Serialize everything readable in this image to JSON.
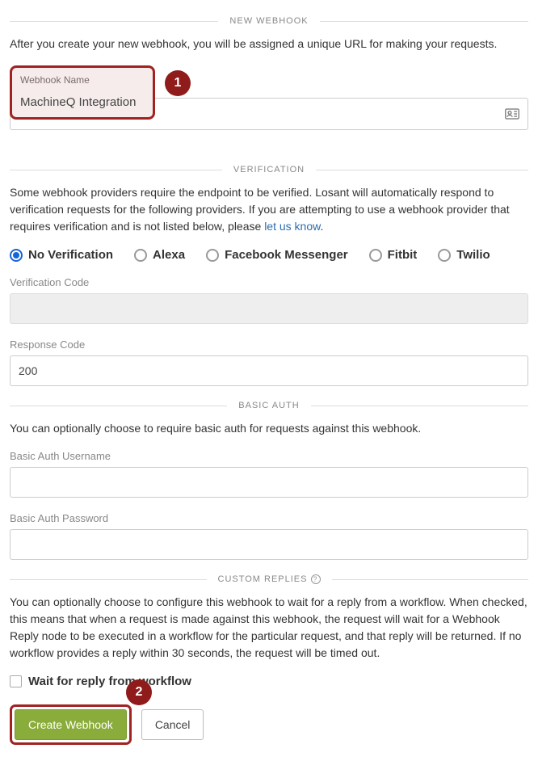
{
  "sections": {
    "new_webhook": {
      "title": "NEW WEBHOOK",
      "desc": "After you create your new webhook, you will be assigned a unique URL for making your requests.",
      "name_label": "Webhook Name",
      "name_value": "MachineQ Integration"
    },
    "verification": {
      "title": "VERIFICATION",
      "desc_prefix": "Some webhook providers require the endpoint to be verified. Losant will automatically respond to verification requests for the following providers. If you are attempting to use a webhook provider that requires verification and is not listed below, please ",
      "desc_link": "let us know",
      "desc_suffix": ".",
      "options": [
        "No Verification",
        "Alexa",
        "Facebook Messenger",
        "Fitbit",
        "Twilio"
      ],
      "selected": "No Verification",
      "verification_code_label": "Verification Code",
      "verification_code_value": "",
      "response_code_label": "Response Code",
      "response_code_value": "200"
    },
    "basic_auth": {
      "title": "BASIC AUTH",
      "desc": "You can optionally choose to require basic auth for requests against this webhook.",
      "username_label": "Basic Auth Username",
      "username_value": "",
      "password_label": "Basic Auth Password",
      "password_value": ""
    },
    "custom_replies": {
      "title": "CUSTOM REPLIES",
      "desc": "You can optionally choose to configure this webhook to wait for a reply from a workflow. When checked, this means that when a request is made against this webhook, the request will wait for a Webhook Reply node to be executed in a workflow for the particular request, and that reply will be returned. If no workflow provides a reply within 30 seconds, the request will be timed out.",
      "checkbox_label": "Wait for reply from workflow",
      "checkbox_checked": false
    }
  },
  "buttons": {
    "create": "Create Webhook",
    "cancel": "Cancel"
  },
  "callouts": {
    "one": "1",
    "two": "2"
  }
}
